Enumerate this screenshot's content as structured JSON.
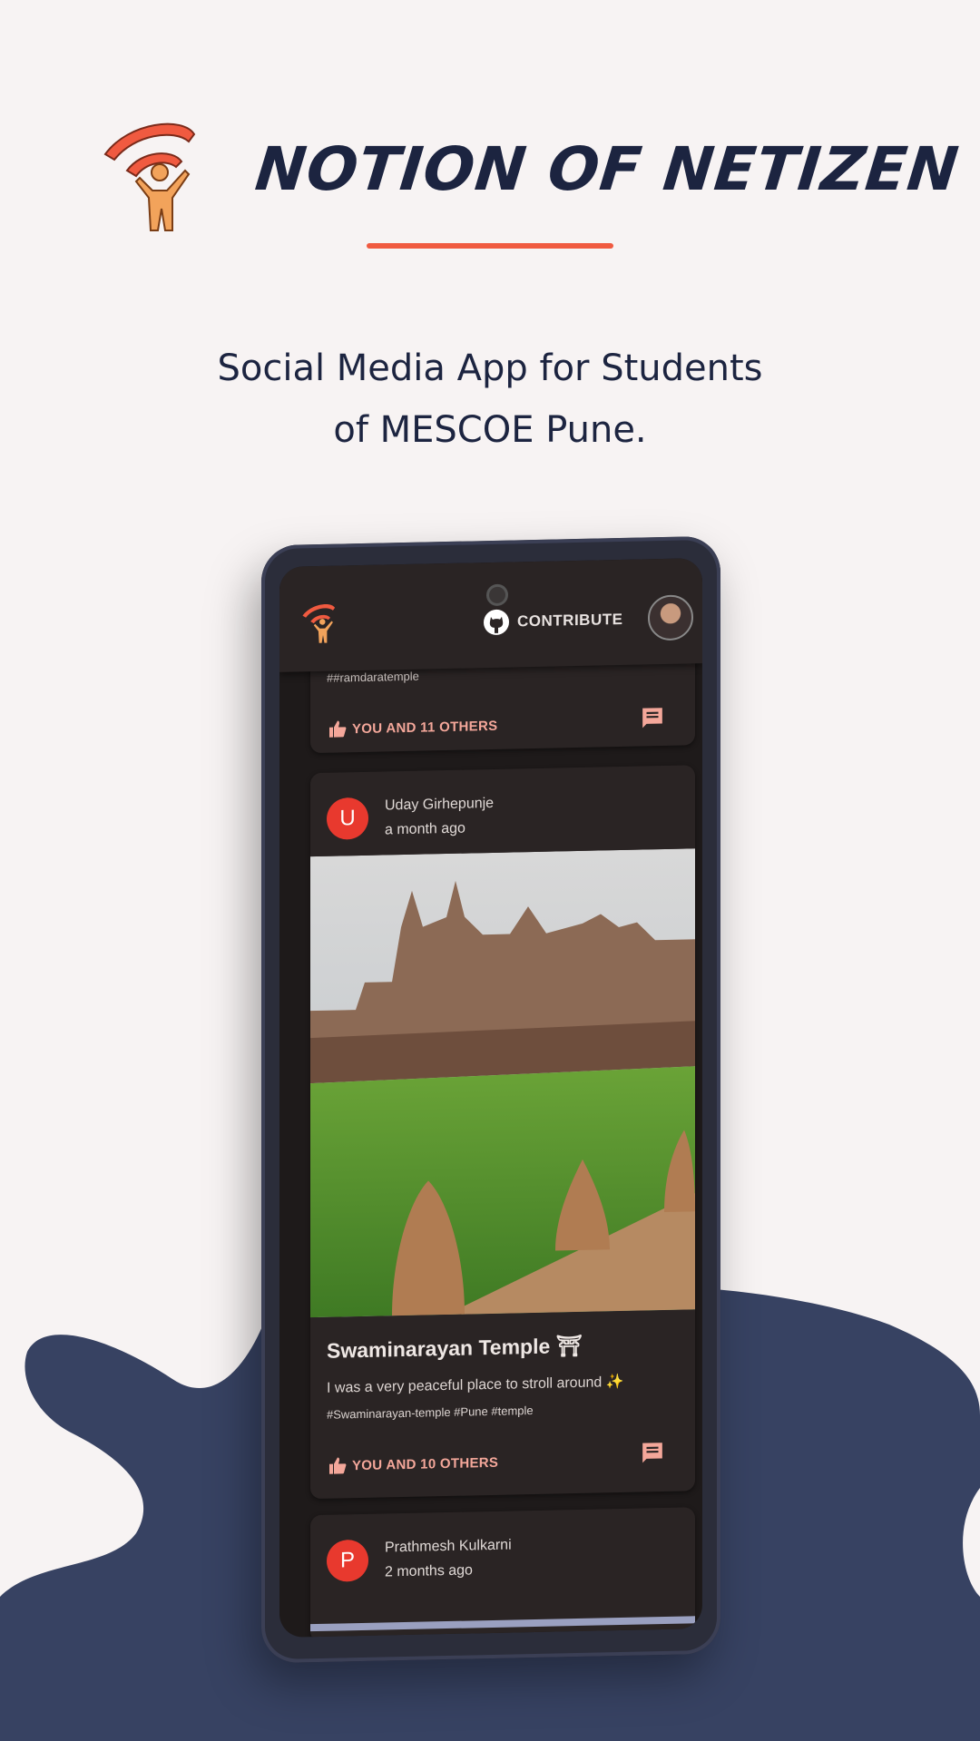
{
  "promo": {
    "app_name": "NOTION OF NETIZEN",
    "tagline_line1": "Social Media App for Students",
    "tagline_line2": "of MESCOE Pune.",
    "logo_icon": "wifi-person-logo-icon",
    "accent_color": "#f05a40",
    "navy_color": "#1c2440",
    "blob_color": "#374262"
  },
  "appbar": {
    "contribute_label": "CONTRIBUTE",
    "github_icon": "github-icon",
    "profile_icon": "profile-avatar"
  },
  "feed": {
    "prev_post": {
      "hashtags": "##ramdaratemple",
      "likes": "YOU AND 11 OTHERS"
    },
    "post": {
      "user_initial": "U",
      "user_name": "Uday Girhepunje",
      "time": "a month ago",
      "title": "Swaminarayan Temple ⛩",
      "text": "I was a very peaceful place to stroll around ✨",
      "hashtags": "#Swaminarayan-temple #Pune #temple",
      "likes": "YOU AND 10 OTHERS"
    },
    "next_post": {
      "user_initial": "P",
      "user_name": "Prathmesh Kulkarni",
      "time": "2 months ago"
    }
  }
}
